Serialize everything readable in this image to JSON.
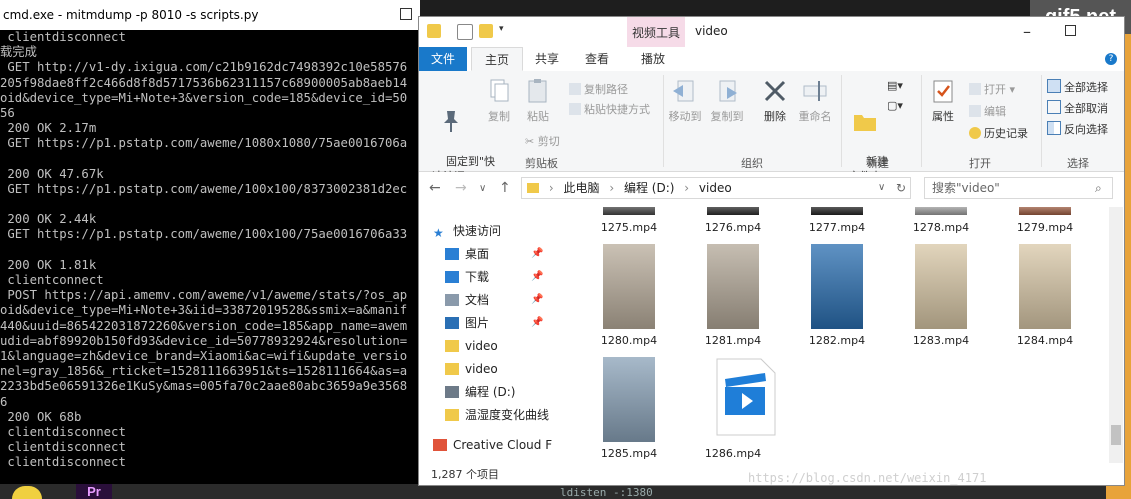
{
  "cmd": {
    "title": "cmd.exe - mitmdump  -p 8010 -s scripts.py",
    "lines": [
      " clientdisconnect",
      "载完成",
      " GET http://v1-dy.ixigua.com/c21b9162dc7498392c10e58576",
      "205f98dae8ff2c466d8f8d5717536b62311157c68900005ab8aeb14",
      "oid&device_type=Mi+Note+3&version_code=185&device_id=50",
      "56",
      " 200 OK 2.17m",
      " GET https://p1.pstatp.com/aweme/1080x1080/75ae0016706a",
      "",
      " 200 OK 47.67k",
      " GET https://p1.pstatp.com/aweme/100x100/8373002381d2ec",
      "",
      " 200 OK 2.44k",
      " GET https://p1.pstatp.com/aweme/100x100/75ae0016706a33",
      "",
      " 200 OK 1.81k",
      " clientconnect",
      " POST https://api.amemv.com/aweme/v1/aweme/stats/?os_ap",
      "oid&device_type=Mi+Note+3&iid=33872019528&ssmix=a&manif",
      "440&uuid=865422031872260&version_code=185&app_name=awem",
      "udid=abf89920b150fd93&device_id=50778932924&resolution=",
      "1&language=zh&device_brand=Xiaomi&ac=wifi&update_versio",
      "nel=gray_1856&_rticket=1528111663951&ts=1528111664&as=a",
      "2233bd5e06591326e1KuSy&mas=005fa70c2aae80abc3659a9e3568",
      "6",
      " 200 OK 68b",
      " clientdisconnect",
      " clientdisconnect",
      " clientdisconnect"
    ]
  },
  "taskbar": {
    "app_label": "Pr",
    "text": "ldisten  -:1380"
  },
  "logo": "gif5.net",
  "explorer": {
    "context_tab": "视频工具",
    "title": "video",
    "tabs": [
      "文件",
      "主页",
      "共享",
      "查看",
      "播放"
    ],
    "ribbon": {
      "pin_label": "固定到\"快\n速访问\"",
      "copy_label": "复制",
      "paste_label": "粘贴",
      "copy_path": "复制路径",
      "paste_shortcut": "粘贴快捷方式",
      "cut": "剪切",
      "move_to": "移动到",
      "copy_to": "复制到",
      "delete": "删除",
      "rename": "重命名",
      "new_folder": "新建\n文件夹",
      "properties": "属性",
      "open": "打开",
      "edit": "编辑",
      "history": "历史记录",
      "select_all": "全部选择",
      "select_none": "全部取消",
      "invert": "反向选择",
      "groups": [
        "剪贴板",
        "组织",
        "新建",
        "打开",
        "选择"
      ]
    },
    "address": {
      "path": [
        "此电脑",
        "编程 (D:)",
        "video"
      ],
      "search_placeholder": "搜索\"video\""
    },
    "nav": [
      {
        "label": "快速访问",
        "icon": "star-icon",
        "pinned": false
      },
      {
        "label": "桌面",
        "icon": "desktop-icon",
        "pinned": true
      },
      {
        "label": "下载",
        "icon": "download-icon",
        "pinned": true
      },
      {
        "label": "文档",
        "icon": "document-icon",
        "pinned": true
      },
      {
        "label": "图片",
        "icon": "picture-icon",
        "pinned": true
      },
      {
        "label": "video",
        "icon": "folder-icon",
        "pinned": false
      },
      {
        "label": "video",
        "icon": "folder-icon",
        "pinned": false
      },
      {
        "label": "编程 (D:)",
        "icon": "drive-icon",
        "pinned": false
      },
      {
        "label": "温湿度变化曲线",
        "icon": "folder-icon",
        "pinned": false
      },
      {
        "label": "Creative Cloud F",
        "icon": "creative-cloud-icon",
        "pinned": false
      }
    ],
    "files_row1": [
      "1275.mp4",
      "1276.mp4",
      "1277.mp4",
      "1278.mp4",
      "1279.mp4"
    ],
    "files_row2": [
      "1280.mp4",
      "1281.mp4",
      "1282.mp4",
      "1283.mp4",
      "1284.mp4"
    ],
    "files_row3": [
      "1285.mp4",
      "1286.mp4"
    ],
    "status": "1,287 个项目"
  },
  "watermark": "https://blog.csdn.net/weixin_4171"
}
